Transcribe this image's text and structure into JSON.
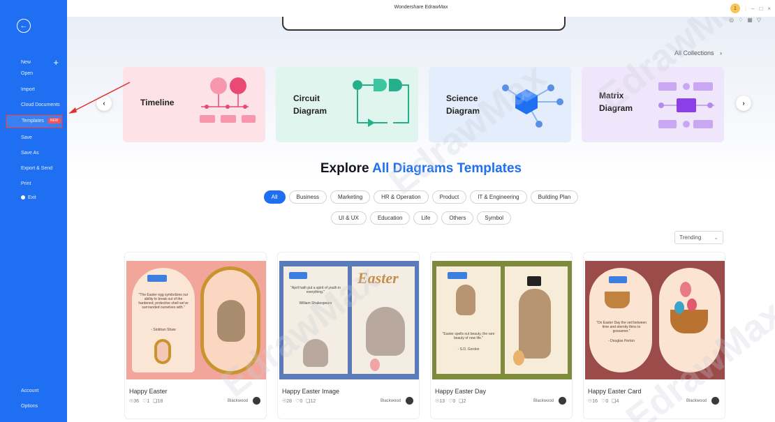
{
  "app": {
    "title": "Wondershare EdrawMax",
    "points": "1"
  },
  "sidebar": {
    "items": [
      {
        "label": "New"
      },
      {
        "label": "Open"
      },
      {
        "label": "Import"
      },
      {
        "label": "Cloud Documents"
      },
      {
        "label": "Templates",
        "badge": "NEW"
      },
      {
        "label": "Save"
      },
      {
        "label": "Save As"
      },
      {
        "label": "Export & Send"
      },
      {
        "label": "Print"
      },
      {
        "label": "Exit"
      }
    ],
    "bottom": [
      {
        "label": "Account"
      },
      {
        "label": "Options"
      }
    ]
  },
  "collections": {
    "link_label": "All Collections",
    "cards": [
      {
        "label": "Timeline",
        "color": "#fde2e8"
      },
      {
        "label": "Circuit Diagram",
        "color": "#dff5ee"
      },
      {
        "label": "Science Diagram",
        "color": "#e4edfb"
      },
      {
        "label": "Matrix Diagram",
        "color": "#efe6fb"
      }
    ]
  },
  "explore": {
    "title_prefix": "Explore",
    "title_accent": "All Diagrams Templates",
    "filters_row1": [
      "All",
      "Business",
      "Marketing",
      "HR & Operation",
      "Product",
      "IT & Engineering",
      "Building Plan"
    ],
    "filters_row2": [
      "UI & UX",
      "Education",
      "Life",
      "Others",
      "Symbol"
    ],
    "active_filter": "All",
    "sort": "Trending"
  },
  "templates": [
    {
      "name": "Happy Easter",
      "views": "36",
      "likes": "1",
      "copies": "18",
      "author": "Blackwood"
    },
    {
      "name": "Happy Easter Image",
      "views": "28",
      "likes": "0",
      "copies": "12",
      "author": "Blackwood"
    },
    {
      "name": "Happy Easter Day",
      "views": "13",
      "likes": "0",
      "copies": "2",
      "author": "Blackwood"
    },
    {
      "name": "Happy Easter Card",
      "views": "16",
      "likes": "0",
      "copies": "4",
      "author": "Blackwood"
    }
  ],
  "thumb_text": {
    "t1_quote": "\"The Easter egg symbolizes our ability to break out of the hardened, protective shell we've surrounded ourselves with.\"",
    "t1_author": "- Siobhan Shaw",
    "t2_quote": "\"April hath put a spirit of youth in everything.\"",
    "t2_author": "William Shakespeare",
    "t2_word": "Easter",
    "t3_quote": "\"Easter spells out beauty, the rare beauty of new life.\"",
    "t3_author": "- S.D. Gordon",
    "t4_quote": "\"On Easter Day the veil between time and eternity thins to gossamer.\"",
    "t4_author": "- Douglas Horton"
  },
  "watermark": "EdrawMax"
}
